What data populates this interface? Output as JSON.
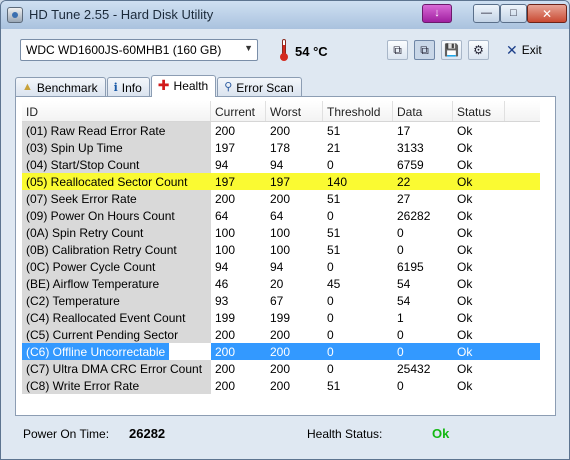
{
  "window": {
    "title": "HD Tune 2.55 - Hard Disk Utility"
  },
  "toolbar": {
    "drive": "WDC WD1600JS-60MHB1 (160 GB)",
    "temperature": "54 °C",
    "exit_label": "Exit"
  },
  "tabs": [
    {
      "label": "Benchmark",
      "icon": "benchmark-icon"
    },
    {
      "label": "Info",
      "icon": "info-icon"
    },
    {
      "label": "Health",
      "icon": "health-cross-icon"
    },
    {
      "label": "Error Scan",
      "icon": "magnifier-icon"
    }
  ],
  "active_tab": "Health",
  "table": {
    "columns": [
      "ID",
      "Current",
      "Worst",
      "Threshold",
      "Data",
      "Status"
    ],
    "rows": [
      [
        "(01) Raw Read Error Rate",
        "200",
        "200",
        "51",
        "17",
        "Ok"
      ],
      [
        "(03) Spin Up Time",
        "197",
        "178",
        "21",
        "3133",
        "Ok"
      ],
      [
        "(04) Start/Stop Count",
        "94",
        "94",
        "0",
        "6759",
        "Ok"
      ],
      [
        "(05) Reallocated Sector Count",
        "197",
        "197",
        "140",
        "22",
        "Ok"
      ],
      [
        "(07) Seek Error Rate",
        "200",
        "200",
        "51",
        "27",
        "Ok"
      ],
      [
        "(09) Power On Hours Count",
        "64",
        "64",
        "0",
        "26282",
        "Ok"
      ],
      [
        "(0A) Spin Retry Count",
        "100",
        "100",
        "51",
        "0",
        "Ok"
      ],
      [
        "(0B) Calibration Retry Count",
        "100",
        "100",
        "51",
        "0",
        "Ok"
      ],
      [
        "(0C) Power Cycle Count",
        "94",
        "94",
        "0",
        "6195",
        "Ok"
      ],
      [
        "(BE) Airflow Temperature",
        "46",
        "20",
        "45",
        "54",
        "Ok"
      ],
      [
        "(C2) Temperature",
        "93",
        "67",
        "0",
        "54",
        "Ok"
      ],
      [
        "(C4) Reallocated Event Count",
        "199",
        "199",
        "0",
        "1",
        "Ok"
      ],
      [
        "(C5) Current Pending Sector",
        "200",
        "200",
        "0",
        "0",
        "Ok"
      ],
      [
        "(C6) Offline Uncorrectable",
        "200",
        "200",
        "0",
        "0",
        "Ok"
      ],
      [
        "(C7) Ultra DMA CRC Error Count",
        "200",
        "200",
        "0",
        "25432",
        "Ok"
      ],
      [
        "(C8) Write Error Rate",
        "200",
        "200",
        "51",
        "0",
        "Ok"
      ]
    ],
    "highlighted_row": 3,
    "selected_row": 13,
    "highlight_color": "#fafa32",
    "selection_color": "#3399ff"
  },
  "status": {
    "power_on_label": "Power On Time:",
    "power_on_value": "26282",
    "health_label": "Health Status:",
    "health_value": "Ok",
    "health_color": "#14b814"
  }
}
